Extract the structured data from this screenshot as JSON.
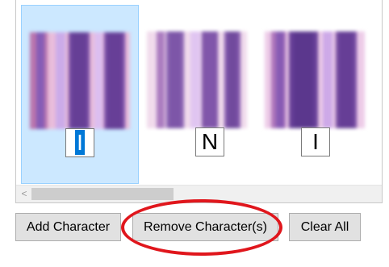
{
  "characters": [
    {
      "char": "I",
      "selected": true
    },
    {
      "char": "N",
      "selected": false
    },
    {
      "char": "I",
      "selected": false
    }
  ],
  "buttons": {
    "add": "Add Character",
    "remove": "Remove Character(s)",
    "clear": "Clear All"
  },
  "scrollbar": {
    "left_arrow": "<"
  },
  "colors": {
    "selection_bg": "#cce8ff",
    "selection_border": "#99d1ff",
    "text_selection": "#0078d7",
    "button_bg": "#e1e1e1",
    "highlight_oval": "#e0161c"
  }
}
